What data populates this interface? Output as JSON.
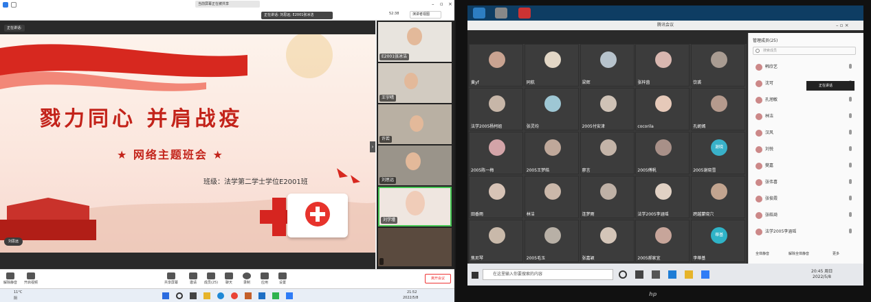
{
  "left": {
    "title": "当前屏幕正在被共享",
    "speaking": "正在讲话: 刘思远; E2001张冰洁",
    "time": "52:38",
    "view_label": "演讲者视图",
    "speaker_chip": "正在讲话:",
    "slide": {
      "title": "戮力同心 并肩战疫",
      "subtitle": "★ 网络主题班会 ★",
      "class_line": "班级：法学第二学士学位E2001班",
      "bottom_chip": "刘思远"
    },
    "video_tiles": [
      "E2001张冰洁",
      "王宇晴",
      "许若",
      "刘思远",
      "刘学瑾",
      ""
    ],
    "bottom_bar": {
      "mute": "解除静音",
      "video": "开启视频",
      "share": "共享屏幕",
      "invite": "邀请",
      "members": "成员(25)",
      "chat": "聊天",
      "record": "录制",
      "apps": "应用",
      "settings": "设置",
      "end": "离开会议"
    },
    "taskbar": {
      "weather_temp": "11°C",
      "weather_desc": "阴",
      "clock_time": "21:52",
      "clock_date": "2022/5/8"
    }
  },
  "right": {
    "window_title": "腾讯会议",
    "grid_names": [
      "黄yf",
      "同航",
      "梁辉",
      "张梓茵",
      "饮裘",
      "法学2005杨柯姐",
      "张灵均",
      "2005付安津",
      "cocorila",
      "孔妮嫣",
      "2005陈一梅",
      "2005王梦皓",
      "廖言",
      "2005傅帆",
      "2005谢晓雪",
      "田香雨",
      "林洁",
      "连梦雨",
      "法学2005李涵瑶",
      "跨越蒙晓穴",
      "焦尼琴",
      "2005毛玉",
      "张嘉颖",
      "2005郝家宜",
      "李蒂基"
    ],
    "avatar_text": {
      "cell14": "谢晓",
      "cell24": "蒂基"
    },
    "member_header": "管理成员(25)",
    "search_placeholder": "搜索成员",
    "speaking_popup": "正在讲话",
    "members": [
      "韩欣艺",
      "沈可",
      "孔旭敏",
      "林洁",
      "汉风",
      "刘悦",
      "樊嘉",
      "张伟喜",
      "张俊霞",
      "张皓琦",
      "法学2005李涵瑶"
    ],
    "footer": {
      "mute_all": "全体静音",
      "unmute_all": "解除全体静音",
      "more": "更多"
    },
    "task_search": "在这里输入你要搜索的内容",
    "clock_time": "20:45 周日",
    "clock_date": "2022/5/8"
  }
}
